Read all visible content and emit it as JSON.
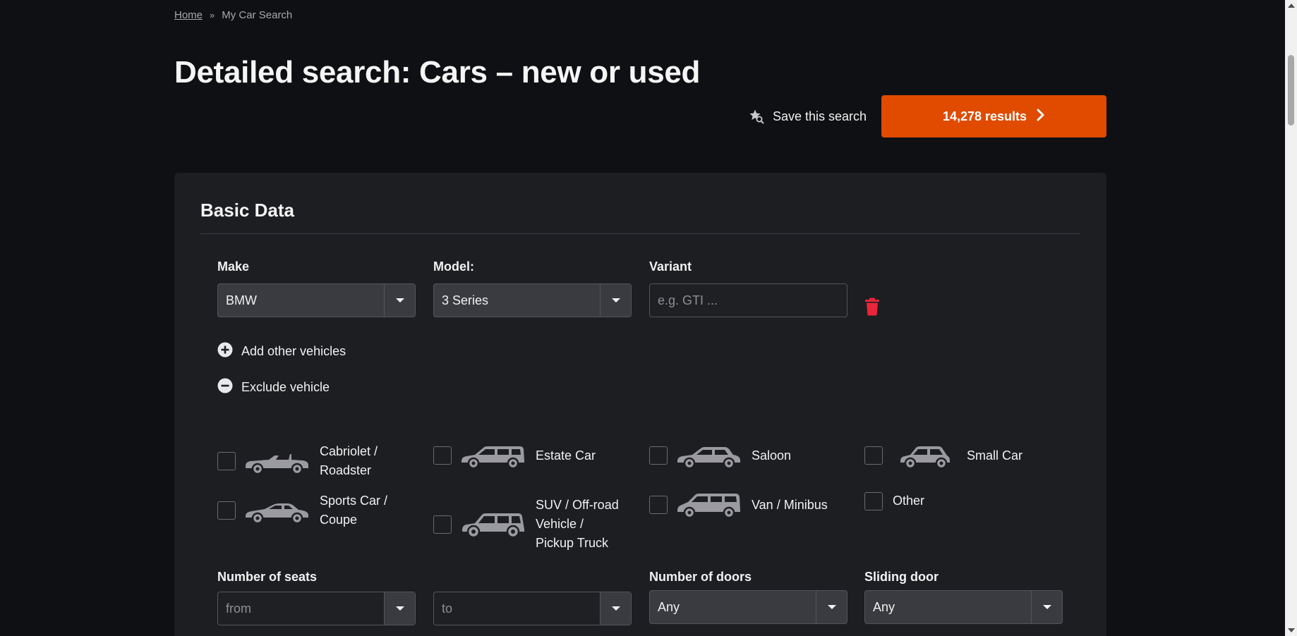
{
  "breadcrumb": {
    "home": "Home",
    "separator": "»",
    "current": "My Car Search"
  },
  "page_title": "Detailed search: Cars – new or used",
  "save_search_label": "Save this search",
  "results_label": "14,278 results",
  "accent_color": "#e04b00",
  "delete_color": "#e8253a",
  "panel": {
    "title": "Basic Data",
    "make": {
      "label": "Make",
      "value": "BMW"
    },
    "model": {
      "label": "Model:",
      "value": "3 Series"
    },
    "variant": {
      "label": "Variant",
      "placeholder": "e.g. GTI ..."
    },
    "add_other_vehicles": "Add other vehicles",
    "exclude_vehicle": "Exclude vehicle",
    "body_types": [
      {
        "label": "Cabriolet / Roadster",
        "icon": "cabriolet-icon"
      },
      {
        "label": "Estate Car",
        "icon": "estate-car-icon"
      },
      {
        "label": "Saloon",
        "icon": "saloon-icon"
      },
      {
        "label": "Small Car",
        "icon": "small-car-icon"
      },
      {
        "label": "Sports Car / Coupe",
        "icon": "sports-car-icon"
      },
      {
        "label": "SUV / Off-road Vehicle / Pickup Truck",
        "icon": "suv-icon"
      },
      {
        "label": "Van / Minibus",
        "icon": "van-icon"
      },
      {
        "label": "Other",
        "icon": ""
      }
    ],
    "seats": {
      "label": "Number of seats",
      "from_placeholder": "from",
      "to_placeholder": "to"
    },
    "doors": {
      "label": "Number of doors",
      "value": "Any"
    },
    "sliding_door": {
      "label": "Sliding door",
      "value": "Any"
    }
  }
}
